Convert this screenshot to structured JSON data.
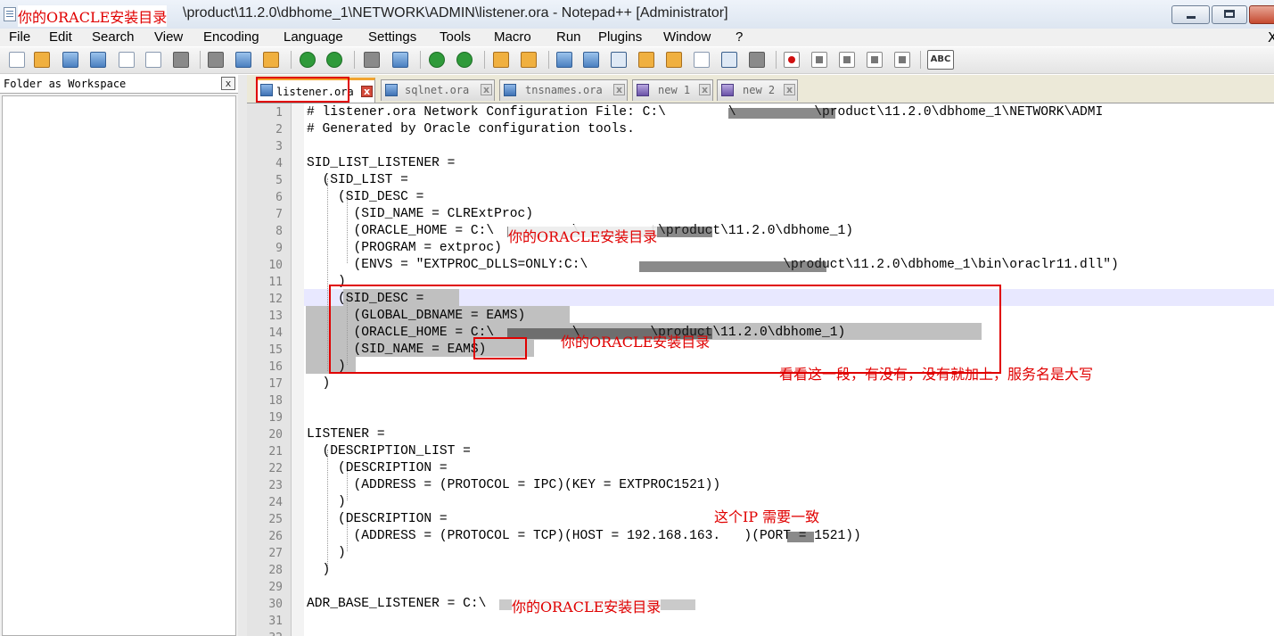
{
  "window": {
    "title_annotation": "你的ORACLE安装目录",
    "title_path": "\\product\\11.2.0\\dbhome_1\\NETWORK\\ADMIN\\listener.ora - Notepad++ [Administrator]"
  },
  "menu": [
    "File",
    "Edit",
    "Search",
    "View",
    "Encoding",
    "Language",
    "Settings",
    "Tools",
    "Macro",
    "Run",
    "Plugins",
    "Window",
    "?"
  ],
  "menu_close": "X",
  "toolbar": {
    "icons": [
      "new-file-icon",
      "open-file-icon",
      "save-icon",
      "save-all-icon",
      "close-icon",
      "close-all-icon",
      "print-icon",
      "cut-icon",
      "copy-icon",
      "paste-icon",
      "undo-icon",
      "redo-icon",
      "find-icon",
      "replace-icon",
      "zoom-in-icon",
      "zoom-out-icon",
      "sync-v-icon",
      "sync-h-icon",
      "word-wrap-icon",
      "show-all-chars-icon",
      "indent-guide-icon",
      "udl-icon",
      "doc-map-icon",
      "function-list-icon",
      "folder-workspace-icon",
      "monitoring-icon",
      "record-macro-icon",
      "stop-record-icon",
      "play-macro-icon",
      "run-multiple-icon",
      "save-macro-icon",
      "spell-check-icon"
    ],
    "spell_label": "ABC"
  },
  "left_panel": {
    "title": "Folder as Workspace",
    "close": "x"
  },
  "tabs": [
    {
      "label": "listener.ora",
      "active": true
    },
    {
      "label": "sqlnet.ora",
      "active": false
    },
    {
      "label": "tnsnames.ora",
      "active": false
    },
    {
      "label": "new 1",
      "active": false
    },
    {
      "label": "new 2",
      "active": false
    }
  ],
  "tab_close": "x",
  "lines": [
    "# listener.ora Network Configuration File: C:\\        \\          \\product\\11.2.0\\dbhome_1\\NETWORK\\ADMI",
    "# Generated by Oracle configuration tools.",
    "",
    "SID_LIST_LISTENER =",
    "  (SID_LIST =",
    "    (SID_DESC =",
    "      (SID_NAME = CLRExtProc)",
    "      (ORACLE_HOME = C:\\          \\         t\\product\\11.2.0\\dbhome_1)",
    "      (PROGRAM = extproc)",
    "      (ENVS = \"EXTPROC_DLLS=ONLY:C:\\                         \\product\\11.2.0\\dbhome_1\\bin\\oraclr11.dll\")",
    "    )",
    "    (SID_DESC =",
    "      (GLOBAL_DBNAME = EAMS)",
    "      (ORACLE_HOME = C:\\          \\         \\product\\11.2.0\\dbhome_1)",
    "      (SID_NAME = EAMS)",
    "    )",
    "  )",
    "",
    "",
    "LISTENER =",
    "  (DESCRIPTION_LIST =",
    "    (DESCRIPTION =",
    "      (ADDRESS = (PROTOCOL = IPC)(KEY = EXTPROC1521))",
    "    )",
    "    (DESCRIPTION =",
    "      (ADDRESS = (PROTOCOL = TCP)(HOST = 192.168.163.   )(PORT = 1521))",
    "    )",
    "  )",
    "",
    "ADR_BASE_LISTENER = C:\\",
    "",
    ""
  ],
  "line_numbers": [
    "1",
    "2",
    "3",
    "4",
    "5",
    "6",
    "7",
    "8",
    "9",
    "10",
    "11",
    "12",
    "13",
    "14",
    "15",
    "16",
    "17",
    "18",
    "19",
    "20",
    "21",
    "22",
    "23",
    "24",
    "25",
    "26",
    "27",
    "28",
    "29",
    "30",
    "31",
    "32"
  ],
  "annotations": {
    "oracle_dir_1": "你的ORACLE安装目录",
    "oracle_dir_2": "你的ORACLE安装目录",
    "oracle_dir_3": "你的ORACLE安装目录",
    "check_section": "看看这一段，有没有，没有就加上，服务名是大写",
    "ip_note": "这个IP   需要一致"
  },
  "colors": {
    "annotation_red": "#e00000",
    "selection_gray": "#c0c0c0",
    "active_tab_accent": "#f2a430"
  }
}
